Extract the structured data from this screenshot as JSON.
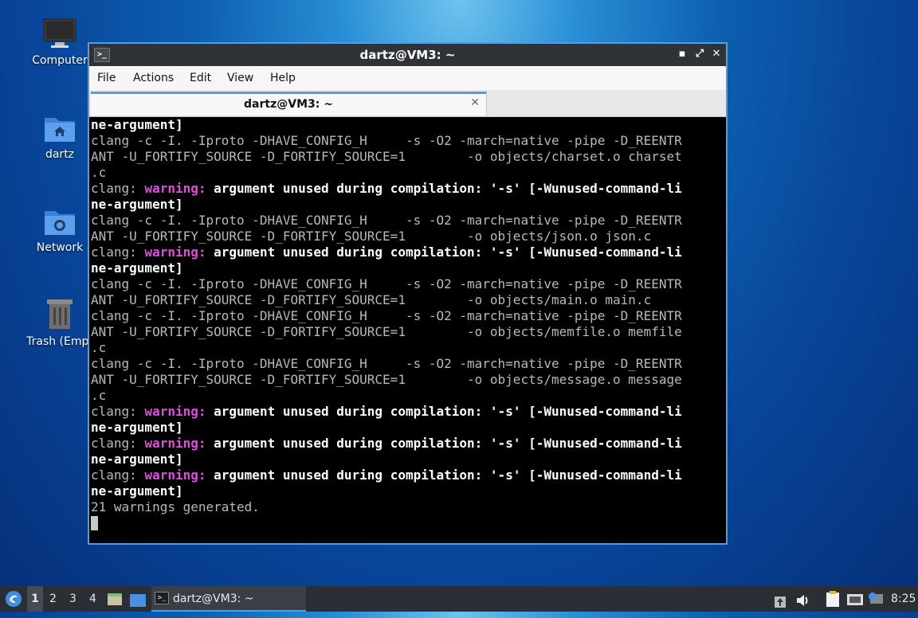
{
  "desktop": {
    "icons": [
      {
        "label": "Computer",
        "icon": "monitor-icon"
      },
      {
        "label": "dartz",
        "icon": "home-folder-icon"
      },
      {
        "label": "Network",
        "icon": "network-folder-icon"
      },
      {
        "label": "Trash (Empt",
        "icon": "trash-icon"
      }
    ]
  },
  "window": {
    "title": "dartz@VM3: ~",
    "controls": {
      "minimize": "▪",
      "maximize": "⤢",
      "close": "✕"
    },
    "menu": [
      "File",
      "Actions",
      "Edit",
      "View",
      "Help"
    ],
    "tab": {
      "label": "dartz@VM3: ~",
      "close": "✕"
    }
  },
  "terminal": {
    "lines": [
      [
        {
          "t": "ne-argument]",
          "s": "b"
        }
      ],
      [
        {
          "t": "clang -c -I. -Iproto -DHAVE_CONFIG_H     -s -O2 -march=native -pipe -D_REENTR",
          "s": ""
        }
      ],
      [
        {
          "t": "ANT -U_FORTIFY_SOURCE -D_FORTIFY_SOURCE=1        -o objects/charset.o charset",
          "s": ""
        }
      ],
      [
        {
          "t": ".c",
          "s": ""
        }
      ],
      [
        {
          "t": "clang: ",
          "s": ""
        },
        {
          "t": "warning: ",
          "s": "w"
        },
        {
          "t": "argument unused during compilation: '-s' [-Wunused-command-li",
          "s": "b"
        }
      ],
      [
        {
          "t": "ne-argument]",
          "s": "b"
        }
      ],
      [
        {
          "t": "clang -c -I. -Iproto -DHAVE_CONFIG_H     -s -O2 -march=native -pipe -D_REENTR",
          "s": ""
        }
      ],
      [
        {
          "t": "ANT -U_FORTIFY_SOURCE -D_FORTIFY_SOURCE=1        -o objects/json.o json.c",
          "s": ""
        }
      ],
      [
        {
          "t": "clang: ",
          "s": ""
        },
        {
          "t": "warning: ",
          "s": "w"
        },
        {
          "t": "argument unused during compilation: '-s' [-Wunused-command-li",
          "s": "b"
        }
      ],
      [
        {
          "t": "ne-argument]",
          "s": "b"
        }
      ],
      [
        {
          "t": "clang -c -I. -Iproto -DHAVE_CONFIG_H     -s -O2 -march=native -pipe -D_REENTR",
          "s": ""
        }
      ],
      [
        {
          "t": "ANT -U_FORTIFY_SOURCE -D_FORTIFY_SOURCE=1        -o objects/main.o main.c",
          "s": ""
        }
      ],
      [
        {
          "t": "clang -c -I. -Iproto -DHAVE_CONFIG_H     -s -O2 -march=native -pipe -D_REENTR",
          "s": ""
        }
      ],
      [
        {
          "t": "ANT -U_FORTIFY_SOURCE -D_FORTIFY_SOURCE=1        -o objects/memfile.o memfile",
          "s": ""
        }
      ],
      [
        {
          "t": ".c",
          "s": ""
        }
      ],
      [
        {
          "t": "clang -c -I. -Iproto -DHAVE_CONFIG_H     -s -O2 -march=native -pipe -D_REENTR",
          "s": ""
        }
      ],
      [
        {
          "t": "ANT -U_FORTIFY_SOURCE -D_FORTIFY_SOURCE=1        -o objects/message.o message",
          "s": ""
        }
      ],
      [
        {
          "t": ".c",
          "s": ""
        }
      ],
      [
        {
          "t": "clang: ",
          "s": ""
        },
        {
          "t": "warning: ",
          "s": "w"
        },
        {
          "t": "argument unused during compilation: '-s' [-Wunused-command-li",
          "s": "b"
        }
      ],
      [
        {
          "t": "ne-argument]",
          "s": "b"
        }
      ],
      [
        {
          "t": "clang: ",
          "s": ""
        },
        {
          "t": "warning: ",
          "s": "w"
        },
        {
          "t": "argument unused during compilation: '-s' [-Wunused-command-li",
          "s": "b"
        }
      ],
      [
        {
          "t": "ne-argument]",
          "s": "b"
        }
      ],
      [
        {
          "t": "clang: ",
          "s": ""
        },
        {
          "t": "warning: ",
          "s": "w"
        },
        {
          "t": "argument unused during compilation: '-s' [-Wunused-command-li",
          "s": "b"
        }
      ],
      [
        {
          "t": "ne-argument]",
          "s": "b"
        }
      ],
      [
        {
          "t": "21 warnings generated.",
          "s": ""
        }
      ]
    ]
  },
  "taskbar": {
    "workspaces": [
      "1",
      "2",
      "3",
      "4"
    ],
    "active_workspace": "1",
    "task_label": "dartz@VM3: ~",
    "clock": "8:25"
  },
  "colors": {
    "accent": "#5a9be0",
    "warning": "#e34ce0",
    "terminal_bg": "#000000"
  }
}
